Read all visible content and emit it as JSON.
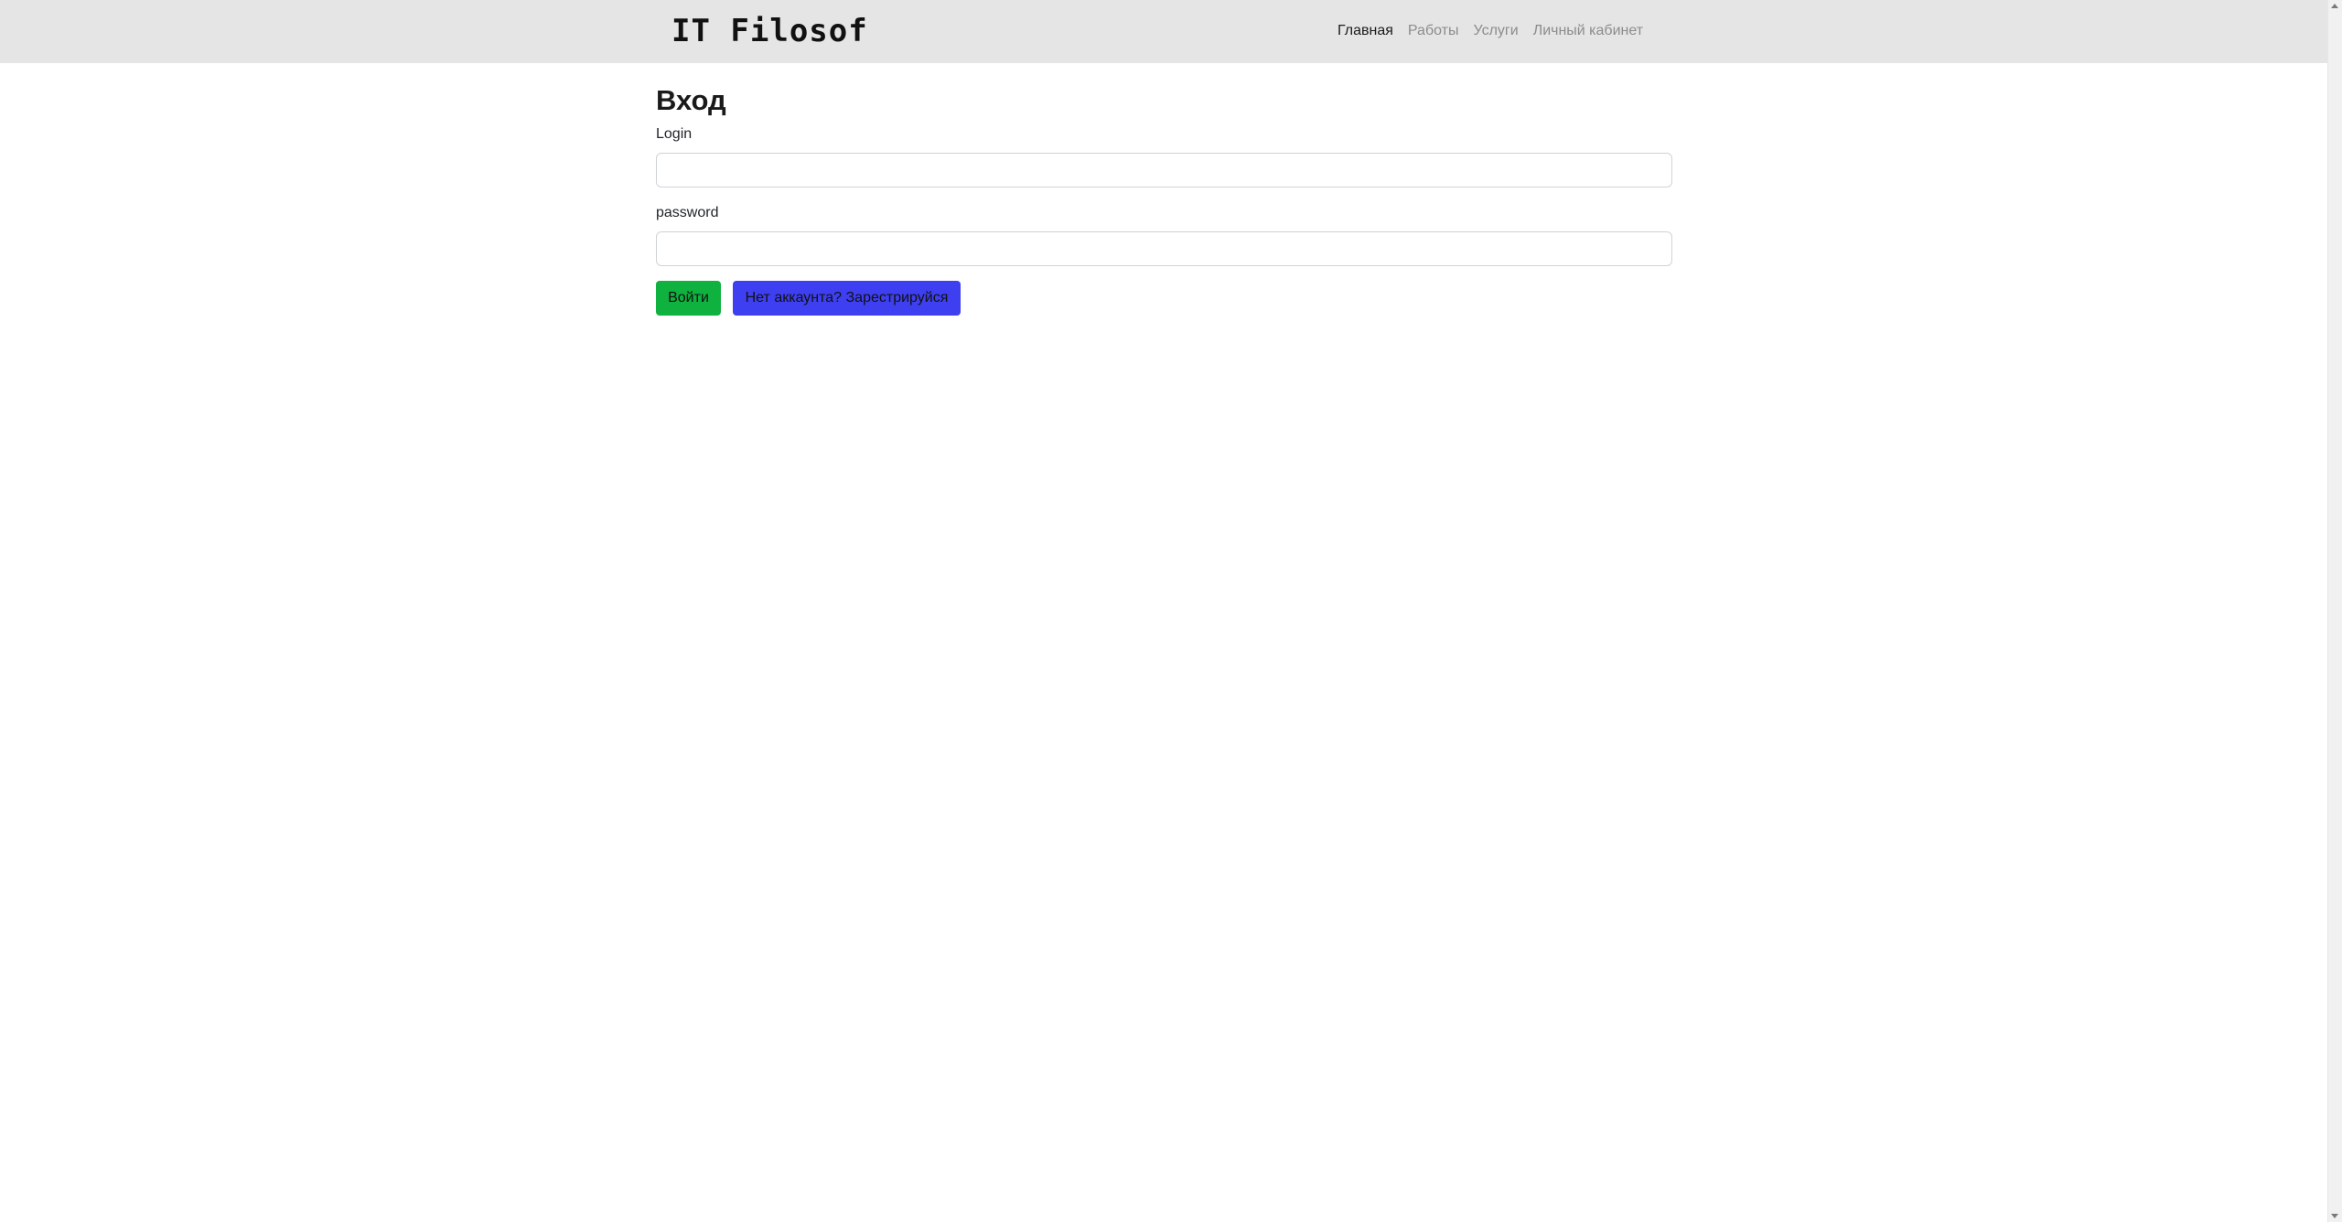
{
  "navbar": {
    "brand": "IT Filosof",
    "links": [
      {
        "label": "Главная",
        "active": true
      },
      {
        "label": "Работы",
        "active": false
      },
      {
        "label": "Услуги",
        "active": false
      },
      {
        "label": "Личный кабинет",
        "active": false
      }
    ],
    "background": "#e5e5e5"
  },
  "form": {
    "title": "Вход",
    "login_label": "Login",
    "login_value": "",
    "password_label": "password",
    "password_value": "",
    "submit_label": "Войти",
    "register_label": "Нет аккаунта? Зарестрируйся"
  },
  "colors": {
    "submit_button": "#0fb13f",
    "register_button": "#3d3ff0"
  },
  "icons": {
    "scroll_up": "scroll-up-arrow-icon",
    "scroll_down": "scroll-down-arrow-icon"
  }
}
